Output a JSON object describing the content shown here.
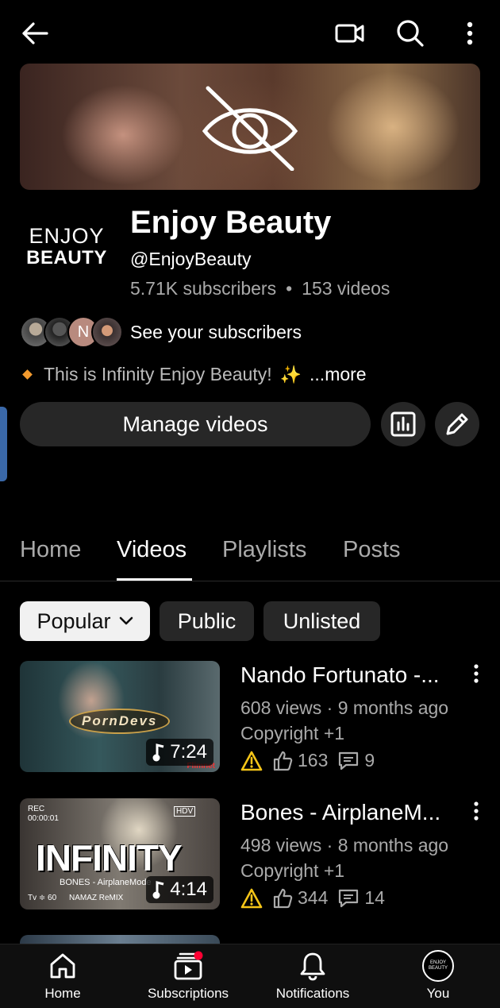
{
  "channel": {
    "name": "Enjoy Beauty",
    "handle": "@EnjoyBeauty",
    "subscribers": "5.71K subscribers",
    "videos_count": "153 videos",
    "stats_separator": "•",
    "logo_line1": "ENJOY",
    "logo_line2": "BEAUTY",
    "see_subscribers": "See your subscribers",
    "subscriber_avatar_letter": "N",
    "description": "This is Infinity Enjoy Beauty!",
    "description_more": "...more",
    "manage_videos": "Manage videos"
  },
  "tabs": [
    "Home",
    "Videos",
    "Playlists",
    "Posts"
  ],
  "active_tab": "Videos",
  "filters": {
    "selected": "Popular",
    "public": "Public",
    "unlisted": "Unlisted"
  },
  "videos": [
    {
      "title": "Nando Fortunato -...",
      "meta": "608 views · 9 months ago",
      "copyright": "Copyright +1",
      "likes": "163",
      "comments": "9",
      "duration": "7:24",
      "thumb_text": "PornDevs",
      "thumb_sub": "Flimnet"
    },
    {
      "title": "Bones - AirplaneM...",
      "meta": "498 views · 8 months ago",
      "copyright": "Copyright +1",
      "likes": "344",
      "comments": "14",
      "duration": "4:14",
      "thumb_text": "INFINITY",
      "thumb_sub": "BONES - AirplaneMode",
      "thumb_rec": "REC",
      "thumb_time": "00:00:01",
      "thumb_remix": "NAMAZ ReMIX",
      "thumb_hdv": "HDV",
      "thumb_tv": "Tv ≑ 60"
    }
  ],
  "bottom_nav": {
    "home": "Home",
    "subscriptions": "Subscriptions",
    "notifications": "Notifications",
    "you": "You",
    "you_avatar_text": "ENJOY BEAUTY"
  },
  "colors": {
    "background": "#000000",
    "surface": "#272727",
    "secondary_text": "#aaaaaa",
    "warning": "#f5c518",
    "notification_dot": "#ff0033"
  }
}
